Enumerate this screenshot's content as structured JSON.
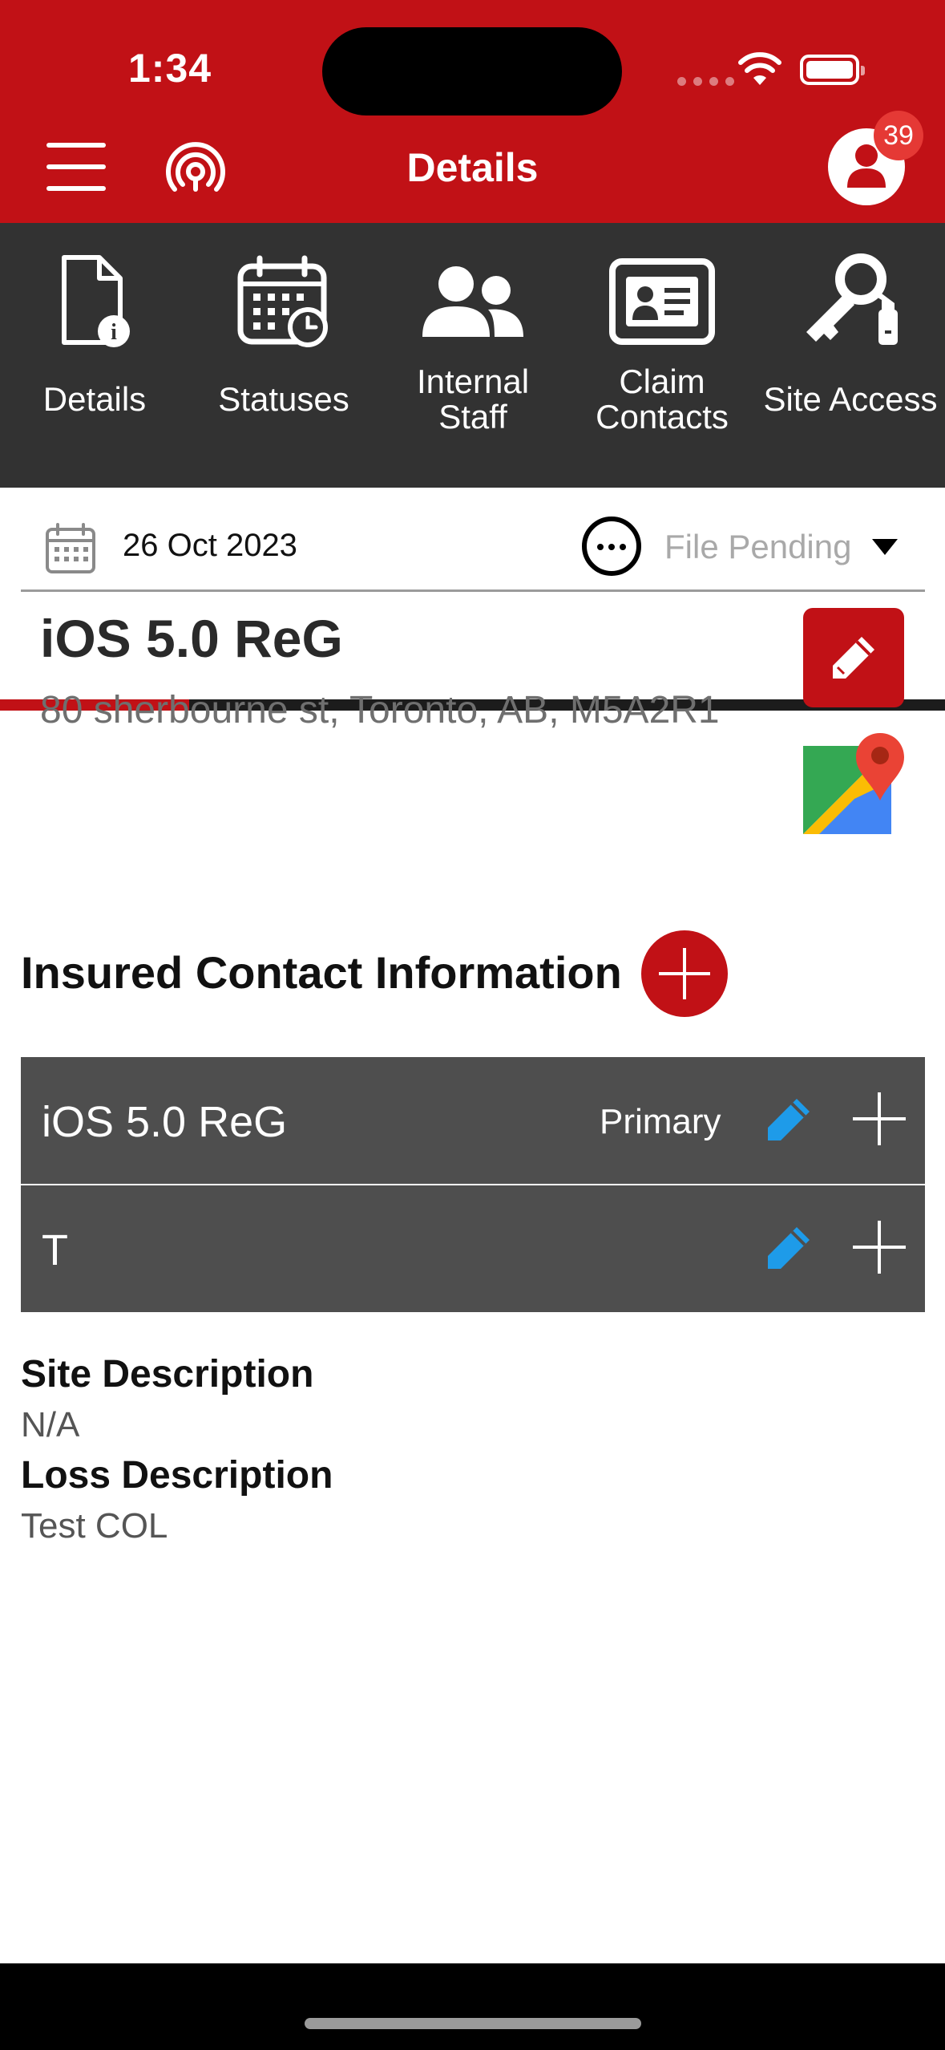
{
  "status_bar": {
    "time": "1:34"
  },
  "header": {
    "title": "Details",
    "notification_count": "39"
  },
  "tabs": [
    {
      "label": "Details",
      "icon": "document-info-icon"
    },
    {
      "label": "Statuses",
      "icon": "calendar-clock-icon"
    },
    {
      "label": "Internal\nStaff",
      "icon": "people-icon"
    },
    {
      "label": "Claim\nContacts",
      "icon": "contact-card-icon"
    },
    {
      "label": "Site Access",
      "icon": "keys-icon"
    }
  ],
  "claim": {
    "date": "26 Oct 2023",
    "status": "File Pending",
    "title": "iOS 5.0 ReG",
    "address": "80 sherbourne st, Toronto, AB, M5A2R1"
  },
  "insured": {
    "section_title": "Insured Contact Information",
    "contacts": [
      {
        "name": "iOS 5.0 ReG",
        "tag": "Primary"
      },
      {
        "name": "T",
        "tag": ""
      }
    ]
  },
  "descriptions": {
    "site_label": "Site Description",
    "site_value": "N/A",
    "loss_label": "Loss Description",
    "loss_value": "Test COL"
  },
  "colors": {
    "brand_red": "#c11116",
    "tab_bar": "#323232",
    "contact_row": "#4e4e4e",
    "edit_blue": "#1e9be9"
  }
}
